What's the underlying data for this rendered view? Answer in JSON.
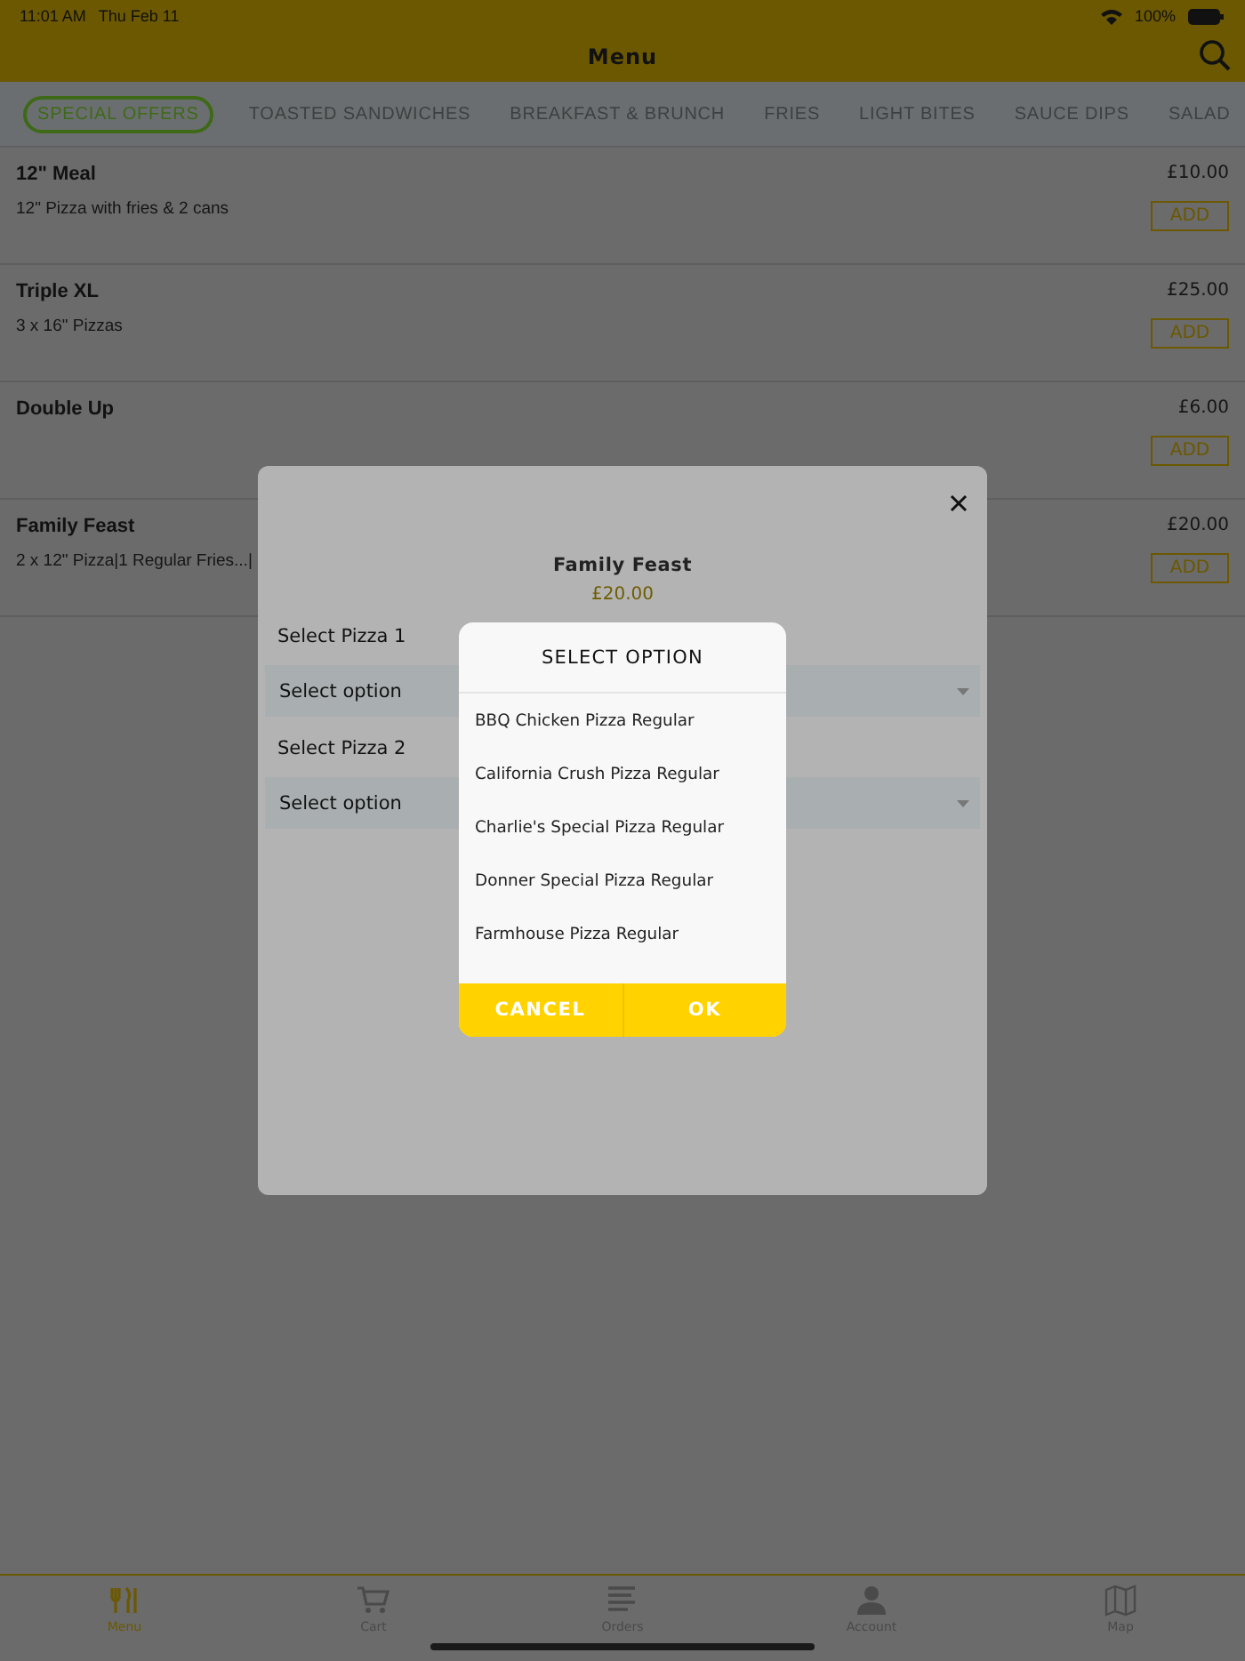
{
  "status_bar": {
    "time": "11:01 AM",
    "date": "Thu Feb 11",
    "battery": "100%"
  },
  "header": {
    "title": "Menu"
  },
  "tabs": [
    {
      "label": "SPECIAL OFFERS",
      "selected": true
    },
    {
      "label": "TOASTED SANDWICHES",
      "selected": false
    },
    {
      "label": "BREAKFAST & BRUNCH",
      "selected": false
    },
    {
      "label": "FRIES",
      "selected": false
    },
    {
      "label": "LIGHT BITES",
      "selected": false
    },
    {
      "label": "SAUCE DIPS",
      "selected": false
    },
    {
      "label": "SALAD",
      "selected": false
    }
  ],
  "items": [
    {
      "name": "12\" Meal",
      "description": "12\" Pizza with fries & 2 cans",
      "price": "£10.00",
      "button": "ADD"
    },
    {
      "name": "Triple XL",
      "description": "3 x 16\" Pizzas",
      "price": "£25.00",
      "button": "ADD"
    },
    {
      "name": "Double Up",
      "price": "£6.00",
      "button": "ADD"
    },
    {
      "name": "Family Feast",
      "description": "2 x 12\" Pizza|1 Regular Fries...|",
      "price": "£20.00",
      "button": "ADD"
    }
  ],
  "modal": {
    "title": "Family Feast",
    "price": "£20.00",
    "selects": [
      {
        "label": "Select Pizza 1",
        "placeholder": "Select option"
      },
      {
        "label": "Select Pizza 2",
        "placeholder": "Select option"
      }
    ]
  },
  "picker": {
    "title": "SELECT OPTION",
    "options": [
      "BBQ Chicken Pizza Regular",
      "California Crush Pizza Regular",
      "Charlie's Special Pizza Regular",
      "Donner Special Pizza Regular",
      "Farmhouse Pizza Regular"
    ],
    "cancel": "CANCEL",
    "ok": "OK"
  },
  "tab_bar": [
    {
      "label": "Menu",
      "selected": true
    },
    {
      "label": "Cart",
      "selected": false
    },
    {
      "label": "Orders",
      "selected": false
    },
    {
      "label": "Account",
      "selected": false
    },
    {
      "label": "Map",
      "selected": false
    }
  ]
}
